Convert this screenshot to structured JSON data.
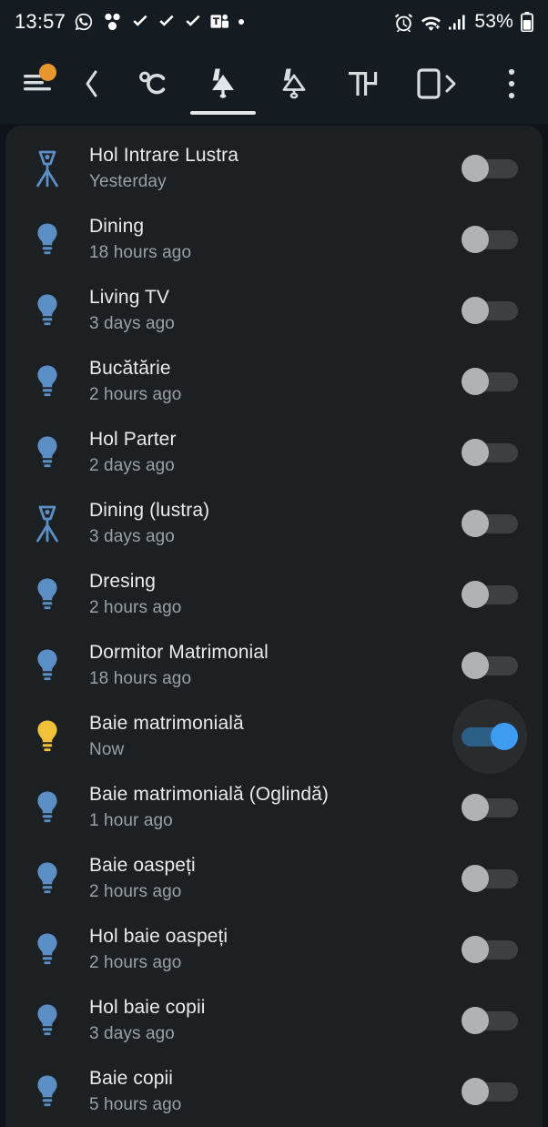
{
  "statusbar": {
    "time": "13:57",
    "battery_percent": "53%",
    "left_icons": [
      "whatsapp-icon",
      "group-icon",
      "check-icon",
      "check-icon",
      "check-icon",
      "ms-teams-icon",
      "dot-icon"
    ],
    "right_icons": [
      "alarm-icon",
      "wifi-icon",
      "signal-icon",
      "battery-icon"
    ]
  },
  "toolbar": {
    "items": [
      {
        "name": "menu-icon",
        "badge": true
      },
      {
        "name": "back-chevron-icon",
        "badge": false
      },
      {
        "name": "temperature-celsius-icon",
        "badge": false
      },
      {
        "name": "lamp-filled-icon",
        "badge": false,
        "active": true
      },
      {
        "name": "lamp-outline-icon",
        "badge": false
      },
      {
        "name": "text-height-icon",
        "badge": false
      },
      {
        "name": "phone-forward-icon",
        "badge": false
      },
      {
        "name": "overflow-menu-icon",
        "badge": false
      }
    ],
    "badge_color": "#e8972e",
    "active_indicator_color": "#e3e6e8"
  },
  "colors": {
    "bulb_off": "#5b8ec4",
    "bulb_on": "#f2c13c",
    "switch_on_thumb": "#3d9cf0",
    "switch_on_track": "#2c5f86",
    "switch_off_thumb": "#b0b2b4",
    "switch_off_track": "#3d4043",
    "card_bg": "#1d2023",
    "chrome_bg": "#141b21"
  },
  "list": {
    "items": [
      {
        "title": "Hol Intrare Lustra",
        "subtitle": "Yesterday",
        "icon": "floor-lamp-icon",
        "on": false
      },
      {
        "title": "Dining",
        "subtitle": "18 hours ago",
        "icon": "bulb-icon",
        "on": false
      },
      {
        "title": "Living TV",
        "subtitle": "3 days ago",
        "icon": "bulb-icon",
        "on": false
      },
      {
        "title": "Bucătărie",
        "subtitle": "2 hours ago",
        "icon": "bulb-icon",
        "on": false
      },
      {
        "title": "Hol Parter",
        "subtitle": "2 days ago",
        "icon": "bulb-icon",
        "on": false
      },
      {
        "title": "Dining (lustra)",
        "subtitle": "3 days ago",
        "icon": "floor-lamp-icon",
        "on": false
      },
      {
        "title": "Dresing",
        "subtitle": "2 hours ago",
        "icon": "bulb-icon",
        "on": false
      },
      {
        "title": "Dormitor Matrimonial",
        "subtitle": "18 hours ago",
        "icon": "bulb-icon",
        "on": false
      },
      {
        "title": "Baie matrimonială",
        "subtitle": "Now",
        "icon": "bulb-icon",
        "on": true
      },
      {
        "title": "Baie matrimonială (Oglindă)",
        "subtitle": "1 hour ago",
        "icon": "bulb-icon",
        "on": false
      },
      {
        "title": "Baie oaspeți",
        "subtitle": "2 hours ago",
        "icon": "bulb-icon",
        "on": false
      },
      {
        "title": "Hol baie oaspeți",
        "subtitle": "2 hours ago",
        "icon": "bulb-icon",
        "on": false
      },
      {
        "title": "Hol baie copii",
        "subtitle": "3 days ago",
        "icon": "bulb-icon",
        "on": false
      },
      {
        "title": "Baie copii",
        "subtitle": "5 hours ago",
        "icon": "bulb-icon",
        "on": false
      }
    ]
  }
}
